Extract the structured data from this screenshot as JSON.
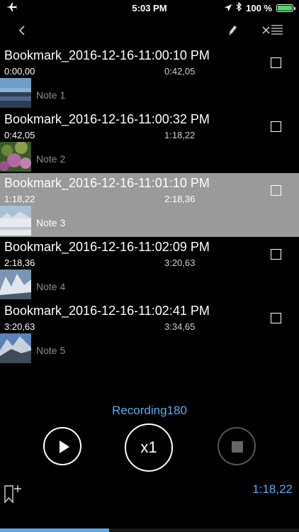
{
  "status_bar": {
    "time": "5:03 PM",
    "battery": "100 %",
    "icons": [
      "airplane-icon",
      "location-arrow-icon",
      "bluetooth-icon",
      "battery-icon"
    ]
  },
  "nav": {
    "icons": [
      "chevron-left-icon",
      "pencil-icon",
      "close-list-icon"
    ]
  },
  "bookmarks": [
    {
      "title": "Bookmark_2016-12-16-11:00:10 PM",
      "start": "0:00,00",
      "end": "0:42,05",
      "note": "Note 1",
      "selected": false
    },
    {
      "title": "Bookmark_2016-12-16-11:00:32 PM",
      "start": "0:42,05",
      "end": "1:18,22",
      "note": "Note 2",
      "selected": false
    },
    {
      "title": "Bookmark_2016-12-16-11:01:10 PM",
      "start": "1:18,22",
      "end": "2:18,36",
      "note": "Note 3",
      "selected": true
    },
    {
      "title": "Bookmark_2016-12-16-11:02:09 PM",
      "start": "2:18,36",
      "end": "3:20,63",
      "note": "Note 4",
      "selected": false
    },
    {
      "title": "Bookmark_2016-12-16-11:02:41 PM",
      "start": "3:20,63",
      "end": "3:34,65",
      "note": "Note 5",
      "selected": false
    }
  ],
  "player": {
    "recording_name": "Recording180",
    "speed": "x1",
    "position": "1:18,22",
    "progress_fraction": 0.365,
    "icons": [
      "play-icon",
      "stop-icon",
      "bookmark-add-icon"
    ]
  },
  "colors": {
    "accent": "#5aaaf0",
    "selected_row": "#9a9a9a",
    "background": "#000000"
  }
}
